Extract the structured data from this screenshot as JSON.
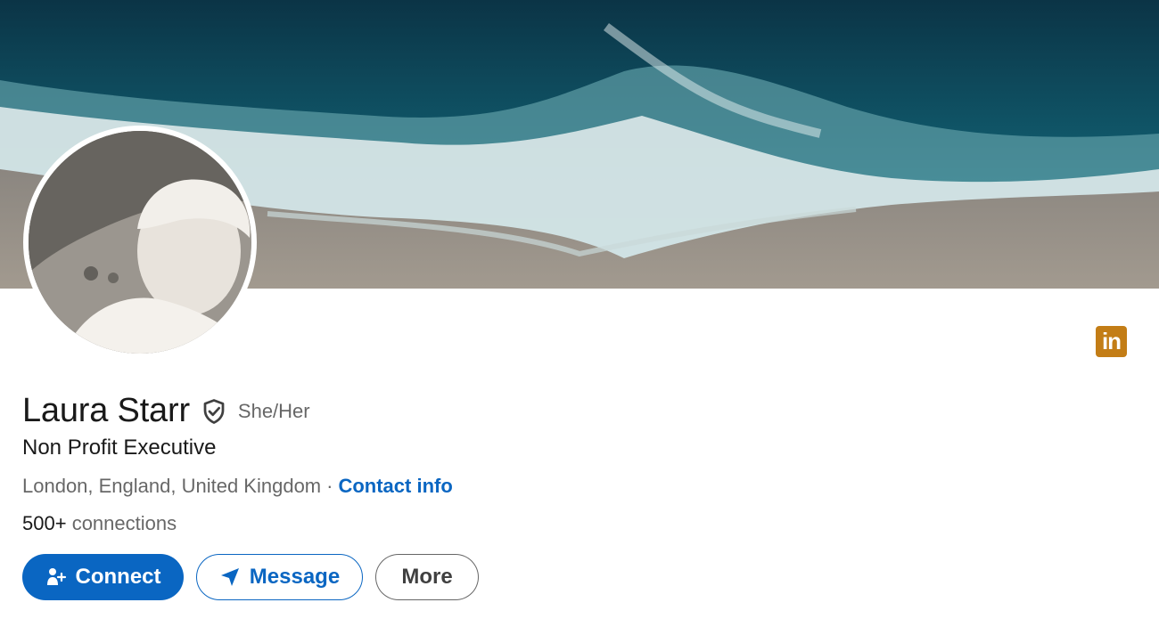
{
  "profile": {
    "name": "Laura Starr",
    "pronouns": "She/Her",
    "headline": "Non Profit Executive",
    "location": "London, England, United Kingdom",
    "separator": "·",
    "contact_info_label": "Contact info",
    "connections_count": "500+",
    "connections_label": "connections"
  },
  "actions": {
    "connect_label": "Connect",
    "message_label": "Message",
    "more_label": "More"
  },
  "badge": {
    "text": "in",
    "icon": "linkedin-icon"
  },
  "icons": {
    "verified": "verified-shield-icon",
    "connect": "add-person-icon",
    "message": "send-paper-plane-icon"
  },
  "colors": {
    "primary": "#0a66c2",
    "linkedin_badge": "#c37d16"
  }
}
